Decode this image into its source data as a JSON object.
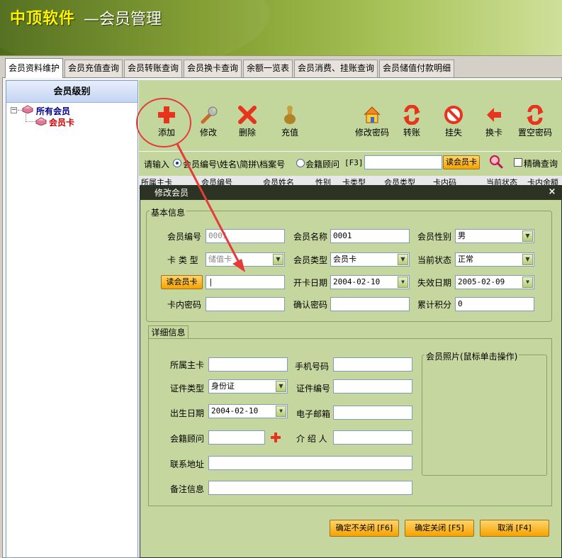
{
  "banner": {
    "brand": "中顶软件",
    "title": "—会员管理"
  },
  "tabs": [
    {
      "label": "会员资料维护"
    },
    {
      "label": "会员充值查询"
    },
    {
      "label": "会员转账查询"
    },
    {
      "label": "会员换卡查询"
    },
    {
      "label": "余额一览表"
    },
    {
      "label": "会员消费、挂账查询"
    },
    {
      "label": "会员储值付款明细"
    }
  ],
  "left": {
    "heading": "会员级别",
    "tree_root": "所有会员",
    "tree_child": "会员卡",
    "expander": "−"
  },
  "toolbar": {
    "add": "添加",
    "edit": "修改",
    "delete": "删除",
    "recharge": "充值",
    "change_password": "修改密码",
    "transfer": "转账",
    "report_loss": "挂失",
    "change_card": "换卡",
    "clear_password": "置空密码"
  },
  "search": {
    "prompt": "请输入",
    "option1": "会员编号\\姓名\\简拼\\档案号",
    "option2": "会籍顾问",
    "hotkey": "[F3]",
    "read_card": "读会员卡",
    "exact": "精确查询",
    "value": ""
  },
  "grid_headers": [
    "所属主卡",
    "会员编号",
    "会员姓名",
    "性别",
    "卡类型",
    "会员类型",
    "卡内码",
    "当前状态",
    "卡内余额"
  ],
  "dialog": {
    "title": "修改会员",
    "close": "×",
    "basic_legend": "基本信息",
    "member_no_label": "会员编号",
    "member_no": "0001",
    "member_name_label": "会员名称",
    "member_name": "0001",
    "gender_label": "会员性别",
    "gender": "男",
    "card_type_label": "卡 类 型",
    "card_type": "储值卡",
    "member_type_label": "会员类型",
    "member_type": "会员卡",
    "status_label": "当前状态",
    "status": "正常",
    "read_card_btn": "读会员卡",
    "card_code": "|",
    "open_date_label": "开卡日期",
    "open_date": "2004-02-10",
    "expire_date_label": "失效日期",
    "expire_date": "2005-02-09",
    "pin_label": "卡内密码",
    "pin": "",
    "confirm_pw_label": "确认密码",
    "confirm_pw": "",
    "points_label": "累计积分",
    "points": "0",
    "detail_tab": "详细信息",
    "main_card_label": "所属主卡",
    "main_card": "",
    "phone_label": "手机号码",
    "phone": "",
    "id_type_label": "证件类型",
    "id_type": "身份证",
    "id_no_label": "证件编号",
    "id_no": "",
    "birth_label": "出生日期",
    "birth": "2004-02-10",
    "email_label": "电子邮箱",
    "email": "",
    "advisor_label": "会籍顾问",
    "advisor": "",
    "referrer_label": "介 绍 人",
    "referrer": "",
    "address_label": "联系地址",
    "address": "",
    "remark_label": "备注信息",
    "remark": "",
    "photo_legend": "会员照片(鼠标单击操作)",
    "btn_save_keep": "确定不关闭 [F6]",
    "btn_save_close": "确定关闭 [F5]",
    "btn_cancel": "取消 [F4]"
  },
  "colors": {
    "accent": "#f5a300",
    "highlight_circle": "#e53b3b"
  }
}
